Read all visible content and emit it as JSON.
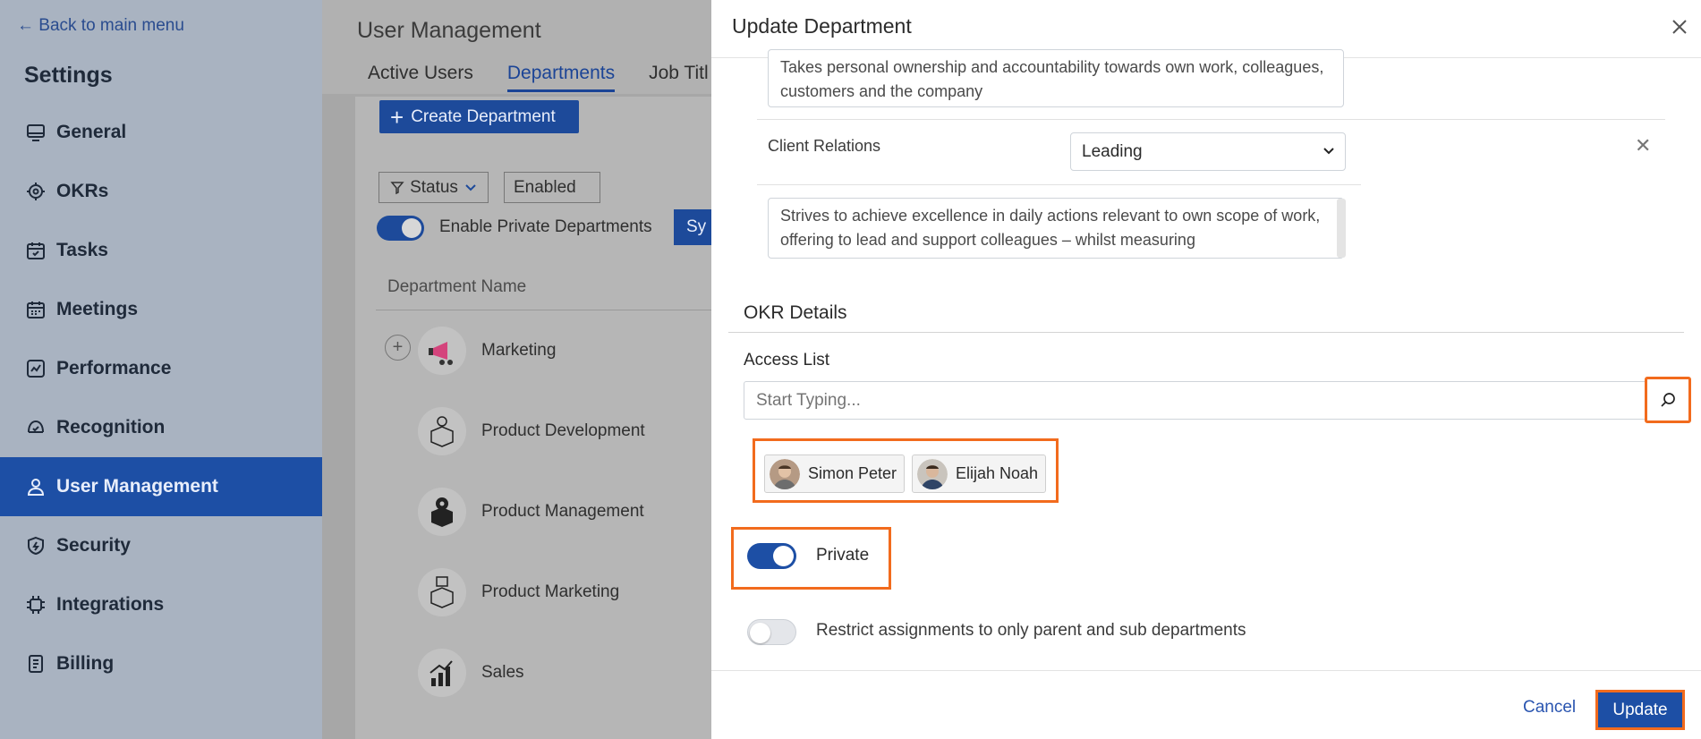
{
  "sidebar": {
    "back_label": "← Back to main menu",
    "title": "Settings",
    "items": [
      {
        "label": "General",
        "icon": "monitor-icon"
      },
      {
        "label": "OKRs",
        "icon": "target-icon"
      },
      {
        "label": "Tasks",
        "icon": "calendar-check-icon"
      },
      {
        "label": "Meetings",
        "icon": "calendar-grid-icon"
      },
      {
        "label": "Performance",
        "icon": "chart-line-icon"
      },
      {
        "label": "Recognition",
        "icon": "recognition-icon"
      },
      {
        "label": "User Management",
        "icon": "user-icon",
        "active": true
      },
      {
        "label": "Security",
        "icon": "shield-icon"
      },
      {
        "label": "Integrations",
        "icon": "chip-icon"
      },
      {
        "label": "Billing",
        "icon": "document-icon"
      }
    ]
  },
  "main": {
    "title": "User Management",
    "tabs": [
      "Active Users",
      "Departments",
      "Job Titl"
    ],
    "active_tab": "Departments",
    "create_label": "Create Department",
    "filter_status": "Status",
    "filter_value": "Enabled",
    "enable_private_label": "Enable Private Departments",
    "sync_label": "Sy",
    "column_header": "Department Name",
    "departments": [
      "Marketing",
      "Product Development",
      "Product Management",
      "Product Marketing",
      "Sales"
    ]
  },
  "drawer": {
    "title": "Update Department",
    "competency_text_1": "Takes personal ownership and accountability towards own work, colleagues, customers and the company",
    "competency_label": "Client Relations",
    "competency_level": "Leading",
    "competency_text_2": "Strives to achieve excellence in daily actions relevant to own scope of work, offering to lead and support colleagues – whilst measuring",
    "okr_section_title": "OKR Details",
    "access_list_label": "Access List",
    "access_placeholder": "Start Typing...",
    "access_users": [
      "Simon Peter",
      "Elijah Noah"
    ],
    "private_label": "Private",
    "private_on": true,
    "restrict_label": "Restrict assignments to only parent and sub departments",
    "restrict_on": false,
    "cancel_label": "Cancel",
    "update_label": "Update"
  },
  "colors": {
    "accent": "#1d4fa5",
    "highlight": "#f26b1d",
    "sidebar_bg": "#a9b3c1"
  }
}
